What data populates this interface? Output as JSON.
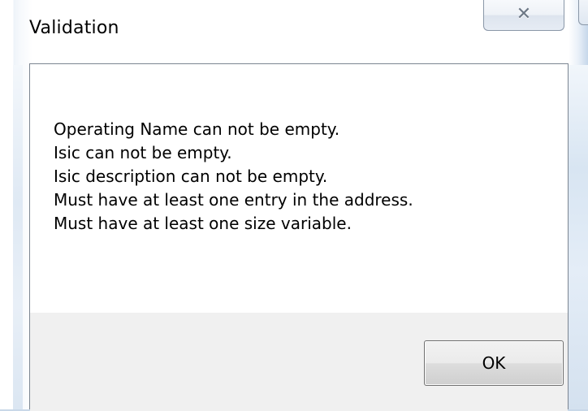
{
  "window": {
    "title": "Validation",
    "close_glyph": "✕",
    "close_icon": "close-icon"
  },
  "messages": [
    "Operating Name can not be empty.",
    "Isic can not be empty.",
    "Isic description can not be empty.",
    "Must have at least one entry in the address.",
    "Must have at least one size variable."
  ],
  "buttons": {
    "ok_label": "OK"
  }
}
